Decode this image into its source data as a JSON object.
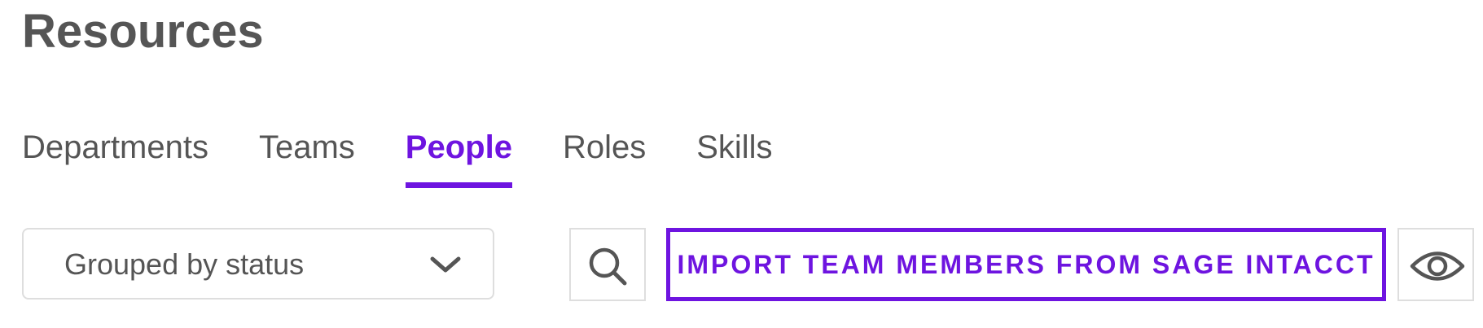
{
  "page": {
    "title": "Resources"
  },
  "tabs": [
    {
      "label": "Departments",
      "active": false
    },
    {
      "label": "Teams",
      "active": false
    },
    {
      "label": "People",
      "active": true
    },
    {
      "label": "Roles",
      "active": false
    },
    {
      "label": "Skills",
      "active": false
    }
  ],
  "toolbar": {
    "group_by": {
      "value": "Grouped by status",
      "icon": "chevron-down-icon"
    },
    "search": {
      "icon": "search-icon"
    },
    "import_label": "IMPORT TEAM MEMBERS FROM SAGE INTACCT",
    "visibility": {
      "icon": "eye-icon"
    }
  },
  "colors": {
    "accent": "#6e14e0",
    "text": "#555555",
    "border": "#dedede"
  }
}
